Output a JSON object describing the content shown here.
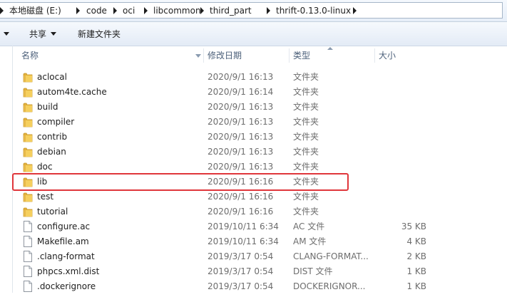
{
  "breadcrumb": [
    "本地磁盘 (E:)",
    "code",
    "oci",
    "libcommon",
    "third_part",
    "thrift-0.13.0-linux"
  ],
  "toolbar": {
    "share_label": "共享",
    "new_folder_label": "新建文件夹"
  },
  "columns": {
    "name": "名称",
    "date": "修改日期",
    "type": "类型",
    "size": "大小"
  },
  "files": [
    {
      "name": "aclocal",
      "date": "2020/9/1 16:13",
      "type": "文件夹",
      "size": "",
      "kind": "folder-icon"
    },
    {
      "name": "autom4te.cache",
      "date": "2020/9/1 16:14",
      "type": "文件夹",
      "size": "",
      "kind": "folder-icon"
    },
    {
      "name": "build",
      "date": "2020/9/1 16:13",
      "type": "文件夹",
      "size": "",
      "kind": "folder-icon"
    },
    {
      "name": "compiler",
      "date": "2020/9/1 16:13",
      "type": "文件夹",
      "size": "",
      "kind": "folder-icon"
    },
    {
      "name": "contrib",
      "date": "2020/9/1 16:13",
      "type": "文件夹",
      "size": "",
      "kind": "folder-icon"
    },
    {
      "name": "debian",
      "date": "2020/9/1 16:13",
      "type": "文件夹",
      "size": "",
      "kind": "folder-icon"
    },
    {
      "name": "doc",
      "date": "2020/9/1 16:13",
      "type": "文件夹",
      "size": "",
      "kind": "folder-icon"
    },
    {
      "name": "lib",
      "date": "2020/9/1 16:16",
      "type": "文件夹",
      "size": "",
      "kind": "folder-icon"
    },
    {
      "name": "test",
      "date": "2020/9/1 16:16",
      "type": "文件夹",
      "size": "",
      "kind": "folder-icon"
    },
    {
      "name": "tutorial",
      "date": "2020/9/1 16:16",
      "type": "文件夹",
      "size": "",
      "kind": "folder-icon"
    },
    {
      "name": "configure.ac",
      "date": "2019/10/11 6:34",
      "type": "AC 文件",
      "size": "35 KB",
      "kind": "file-icon"
    },
    {
      "name": "Makefile.am",
      "date": "2019/10/11 6:34",
      "type": "AM 文件",
      "size": "4 KB",
      "kind": "file-icon"
    },
    {
      "name": ".clang-format",
      "date": "2019/3/17 0:54",
      "type": "CLANG-FORMAT...",
      "size": "2 KB",
      "kind": "file-icon"
    },
    {
      "name": "phpcs.xml.dist",
      "date": "2019/3/17 0:54",
      "type": "DIST 文件",
      "size": "1 KB",
      "kind": "file-icon"
    },
    {
      "name": ".dockerignore",
      "date": "2019/3/17 0:54",
      "type": "DOCKERIGNOR...",
      "size": "1 KB",
      "kind": "file-icon"
    }
  ],
  "colors": {
    "highlight": "#e0363b",
    "folder": "#f0c552",
    "header_text": "#4c607a"
  }
}
